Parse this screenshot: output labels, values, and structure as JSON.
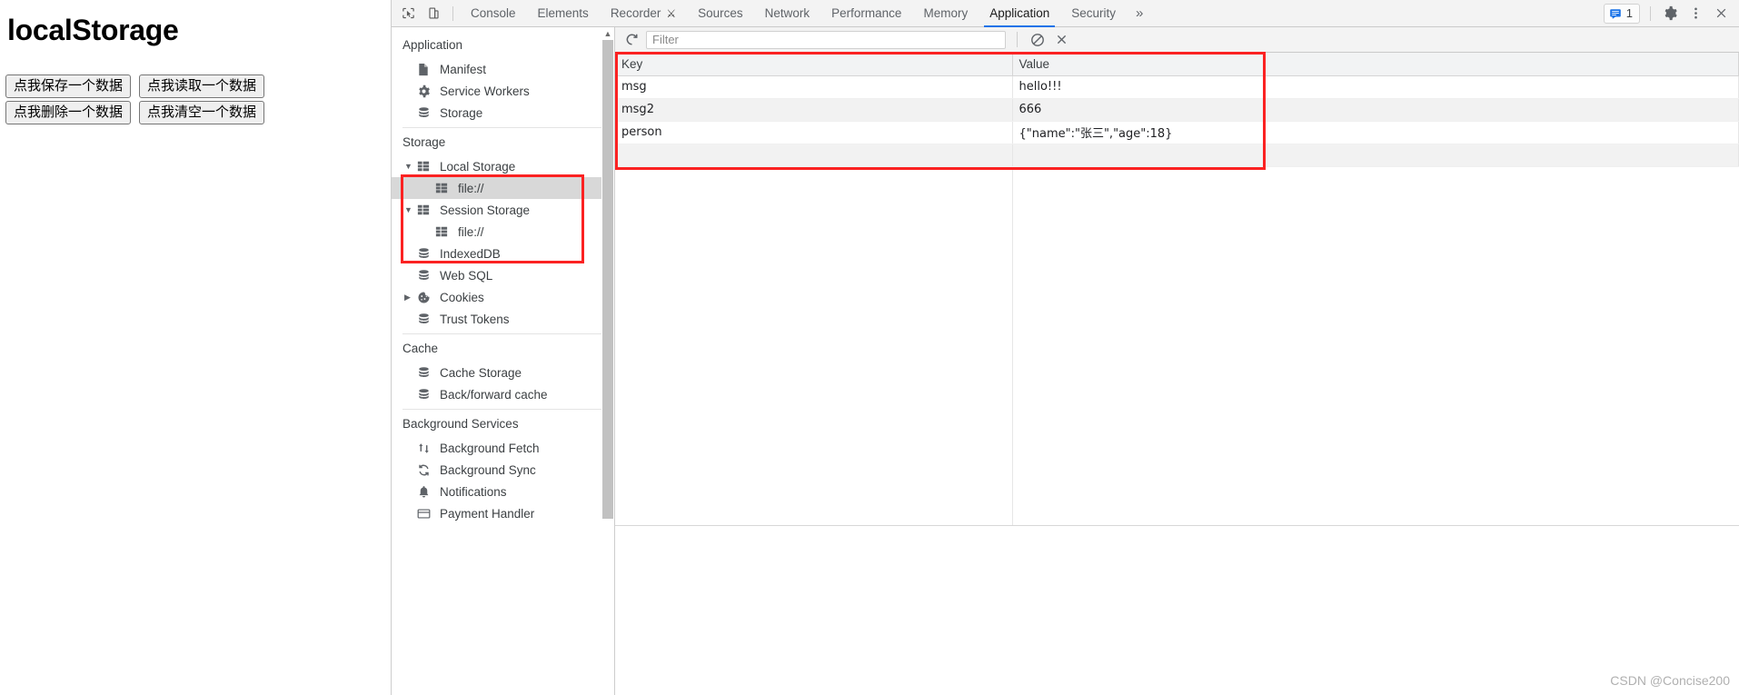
{
  "page": {
    "title": "localStorage",
    "buttons": [
      {
        "label": "点我保存一个数据",
        "name": "save-data-button"
      },
      {
        "label": "点我读取一个数据",
        "name": "read-data-button"
      },
      {
        "label": "点我删除一个数据",
        "name": "delete-data-button"
      },
      {
        "label": "点我清空一个数据",
        "name": "clear-data-button"
      }
    ]
  },
  "devtools": {
    "tabs": [
      {
        "label": "Console",
        "active": false,
        "flask": false
      },
      {
        "label": "Elements",
        "active": false,
        "flask": false
      },
      {
        "label": "Recorder",
        "active": false,
        "flask": true
      },
      {
        "label": "Sources",
        "active": false,
        "flask": false
      },
      {
        "label": "Network",
        "active": false,
        "flask": false
      },
      {
        "label": "Performance",
        "active": false,
        "flask": false
      },
      {
        "label": "Memory",
        "active": false,
        "flask": false
      },
      {
        "label": "Application",
        "active": true,
        "flask": false
      },
      {
        "label": "Security",
        "active": false,
        "flask": false
      }
    ],
    "more_tabs_label": "»",
    "issues_count": "1",
    "accent_color": "#1a73e8",
    "annotation_color": "#fb2222"
  },
  "sidebar": {
    "sections": [
      {
        "title": "Application",
        "items": [
          {
            "label": "Manifest",
            "icon": "document-icon",
            "indent": 1,
            "twisty": "",
            "selected": false
          },
          {
            "label": "Service Workers",
            "icon": "gear-icon",
            "indent": 1,
            "twisty": "",
            "selected": false
          },
          {
            "label": "Storage",
            "icon": "database-icon",
            "indent": 1,
            "twisty": "",
            "selected": false
          }
        ]
      },
      {
        "title": "Storage",
        "items": [
          {
            "label": "Local Storage",
            "icon": "table-grid-icon",
            "indent": 1,
            "twisty": "▼",
            "selected": false
          },
          {
            "label": "file://",
            "icon": "table-grid-icon",
            "indent": 2,
            "twisty": "",
            "selected": true
          },
          {
            "label": "Session Storage",
            "icon": "table-grid-icon",
            "indent": 1,
            "twisty": "▼",
            "selected": false
          },
          {
            "label": "file://",
            "icon": "table-grid-icon",
            "indent": 2,
            "twisty": "",
            "selected": false
          },
          {
            "label": "IndexedDB",
            "icon": "database-icon",
            "indent": 1,
            "twisty": "",
            "selected": false
          },
          {
            "label": "Web SQL",
            "icon": "database-icon",
            "indent": 1,
            "twisty": "",
            "selected": false
          },
          {
            "label": "Cookies",
            "icon": "cookie-icon",
            "indent": 1,
            "twisty": "▶",
            "selected": false
          },
          {
            "label": "Trust Tokens",
            "icon": "database-icon",
            "indent": 1,
            "twisty": "",
            "selected": false
          }
        ]
      },
      {
        "title": "Cache",
        "items": [
          {
            "label": "Cache Storage",
            "icon": "database-icon",
            "indent": 1,
            "twisty": "",
            "selected": false
          },
          {
            "label": "Back/forward cache",
            "icon": "database-icon",
            "indent": 1,
            "twisty": "",
            "selected": false
          }
        ]
      },
      {
        "title": "Background Services",
        "items": [
          {
            "label": "Background Fetch",
            "icon": "updown-arrows-icon",
            "indent": 1,
            "twisty": "",
            "selected": false
          },
          {
            "label": "Background Sync",
            "icon": "sync-icon",
            "indent": 1,
            "twisty": "",
            "selected": false
          },
          {
            "label": "Notifications",
            "icon": "bell-icon",
            "indent": 1,
            "twisty": "",
            "selected": false
          },
          {
            "label": "Payment Handler",
            "icon": "payment-icon",
            "indent": 1,
            "twisty": "",
            "selected": false
          }
        ]
      }
    ]
  },
  "main": {
    "filter_placeholder": "Filter",
    "filter_value": "",
    "refresh_label": "refresh-icon",
    "clear_label": "clear-icon",
    "delete_label": "delete-selected-icon",
    "table": {
      "columns": [
        "Key",
        "Value"
      ],
      "rows": [
        {
          "key": "msg",
          "value": "hello!!!"
        },
        {
          "key": "msg2",
          "value": "666"
        },
        {
          "key": "person",
          "value": "{\"name\":\"张三\",\"age\":18}"
        }
      ]
    }
  },
  "watermark": "CSDN @Concise200"
}
